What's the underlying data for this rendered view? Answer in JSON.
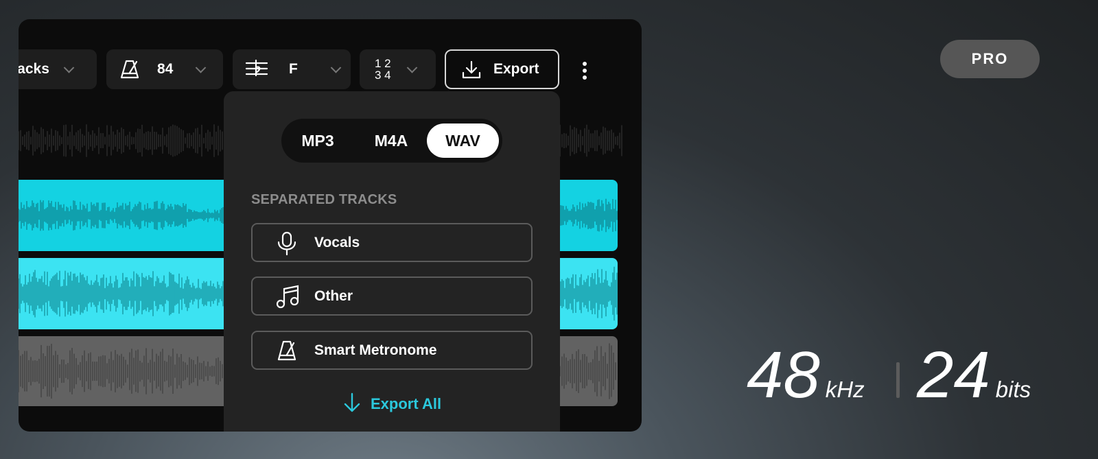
{
  "toolbar": {
    "tracks_label": "racks",
    "tempo_value": "84",
    "key_value": "F",
    "time_signature": {
      "top": "1 2",
      "bottom": "3 4"
    },
    "export_label": "Export"
  },
  "export_menu": {
    "formats": [
      "MP3",
      "M4A",
      "WAV"
    ],
    "selected_format": "WAV",
    "section_title": "SEPARATED TRACKS",
    "stems": [
      {
        "label": "Vocals",
        "icon": "microphone-icon"
      },
      {
        "label": "Other",
        "icon": "music-note-icon"
      },
      {
        "label": "Smart Metronome",
        "icon": "metronome-icon"
      }
    ],
    "export_all_label": "Export All"
  },
  "badge": {
    "label": "PRO"
  },
  "specs": {
    "sample_rate": "48",
    "sample_rate_unit": "kHz",
    "bit_depth": "24",
    "bit_depth_unit": "bits"
  },
  "colors": {
    "accent": "#2bc8dc",
    "track_vocals": "#14d2e2",
    "track_other": "#3ce3f2",
    "track_metronome": "#626262"
  }
}
